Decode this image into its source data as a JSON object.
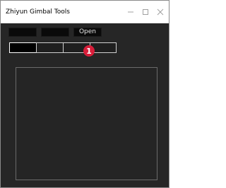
{
  "window": {
    "title": "Zhiyun Gimbal Tools",
    "controls": {
      "minimize_icon": "minimize-icon",
      "maximize_icon": "maximize-icon",
      "close_icon": "close-icon"
    }
  },
  "toolbar": {
    "field1_value": "",
    "field2_value": "",
    "open_label": "Open"
  },
  "tabs": [
    {
      "label": "",
      "active": true
    },
    {
      "label": "",
      "active": false
    },
    {
      "label": "",
      "active": false
    },
    {
      "label": "",
      "active": false
    }
  ],
  "annotation": {
    "marker_number": "1",
    "marker_color": "#d81e3a"
  },
  "colors": {
    "background": "#262626",
    "titlebar": "#ffffff",
    "field": "#0a0a0a",
    "panel_border": "#6a6a6a"
  }
}
